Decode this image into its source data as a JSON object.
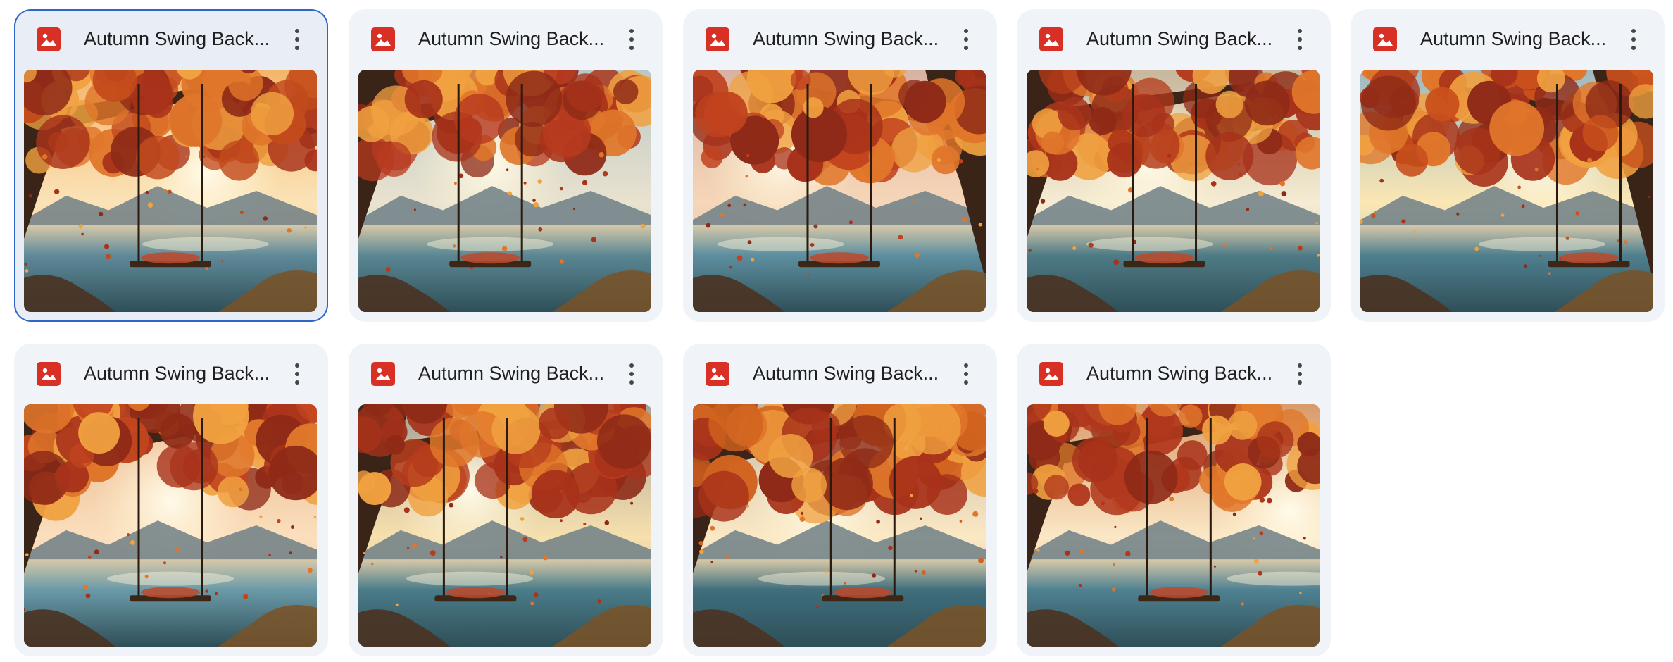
{
  "files": [
    {
      "name": "Autumn Swing Back...",
      "icon": "image-file-icon",
      "selected": true,
      "swing_pos": 0.5,
      "scene": "a"
    },
    {
      "name": "Autumn Swing Back...",
      "icon": "image-file-icon",
      "selected": false,
      "swing_pos": 0.45,
      "scene": "b"
    },
    {
      "name": "Autumn Swing Back...",
      "icon": "image-file-icon",
      "selected": false,
      "swing_pos": 0.5,
      "scene": "c"
    },
    {
      "name": "Autumn Swing Back...",
      "icon": "image-file-icon",
      "selected": false,
      "swing_pos": 0.47,
      "scene": "d"
    },
    {
      "name": "Autumn Swing Back...",
      "icon": "image-file-icon",
      "selected": false,
      "swing_pos": 0.78,
      "scene": "e"
    },
    {
      "name": "Autumn Swing Back...",
      "icon": "image-file-icon",
      "selected": false,
      "swing_pos": 0.5,
      "scene": "f"
    },
    {
      "name": "Autumn Swing Back...",
      "icon": "image-file-icon",
      "selected": false,
      "swing_pos": 0.4,
      "scene": "g"
    },
    {
      "name": "Autumn Swing Back...",
      "icon": "image-file-icon",
      "selected": false,
      "swing_pos": 0.58,
      "scene": "h"
    },
    {
      "name": "Autumn Swing Back...",
      "icon": "image-file-icon",
      "selected": false,
      "swing_pos": 0.52,
      "scene": "i"
    }
  ],
  "colors": {
    "card_bg": "#f0f4f9",
    "selected_border": "#2f64c9",
    "image_icon": "#d93025",
    "text": "#1f1f1f",
    "more_icon": "#444746"
  },
  "more_icon": "more-vert-icon"
}
